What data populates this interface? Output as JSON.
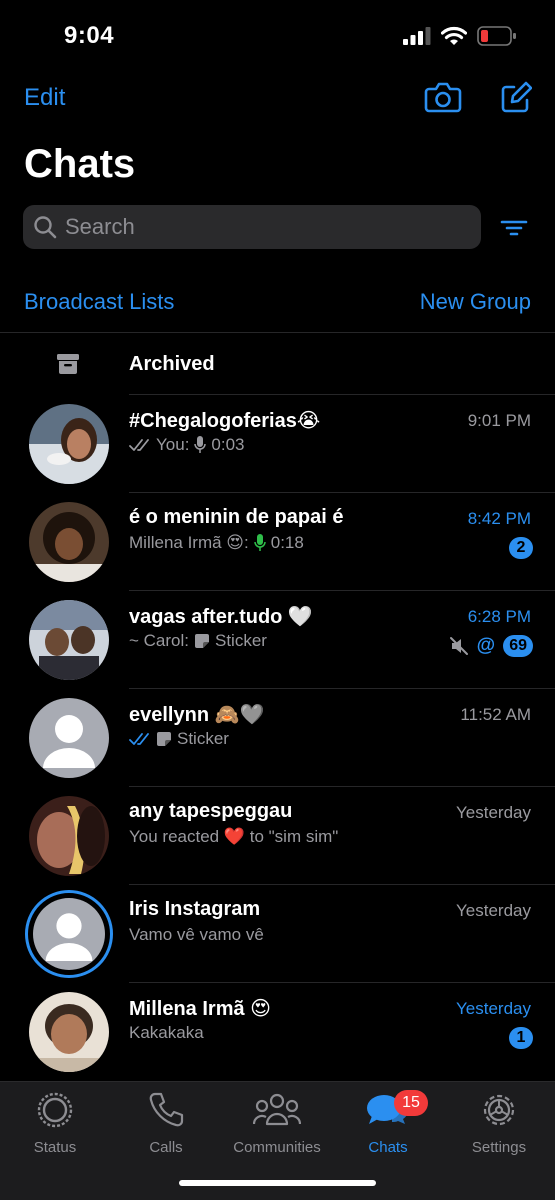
{
  "status_bar": {
    "time": "9:04"
  },
  "header": {
    "edit_label": "Edit",
    "title": "Chats",
    "search_placeholder": "Search",
    "broadcast_label": "Broadcast Lists",
    "new_group_label": "New Group"
  },
  "archived": {
    "label": "Archived"
  },
  "chats": [
    {
      "name": "#Chegalogoferias😭",
      "preview_prefix": "You:",
      "preview_text": "0:03",
      "time": "9:01 PM",
      "badge": ""
    },
    {
      "name": "é o meninin de papai é",
      "preview_prefix": "Millena Irmã 😍:",
      "preview_text": "0:18",
      "time": "8:42 PM",
      "badge": "2"
    },
    {
      "name": "vagas after.tudo 🤍",
      "preview_prefix": "~ Carol:",
      "preview_text": "Sticker",
      "time": "6:28 PM",
      "mention": "@",
      "badge": "69"
    },
    {
      "name": "evellynn 🙈🩶",
      "preview_prefix": "",
      "preview_text": "Sticker",
      "time": "11:52 AM",
      "badge": ""
    },
    {
      "name": "any tapespeggau",
      "preview_prefix": "",
      "preview_text": "You reacted ❤️ to \"sim sim\"",
      "time": "Yesterday",
      "badge": ""
    },
    {
      "name": "Iris Instagram",
      "preview_prefix": "",
      "preview_text": "Vamo vê vamo vê",
      "time": "Yesterday",
      "badge": ""
    },
    {
      "name": "Millena Irmã 😍",
      "preview_prefix": "",
      "preview_text": "Kakakaka",
      "time": "Yesterday",
      "badge": "1"
    }
  ],
  "tabs": [
    {
      "label": "Status"
    },
    {
      "label": "Calls"
    },
    {
      "label": "Communities"
    },
    {
      "label": "Chats",
      "badge": "15"
    },
    {
      "label": "Settings"
    }
  ],
  "colors": {
    "accent": "#2b8ff0",
    "badge_red": "#f23a3a",
    "background": "#000000"
  }
}
